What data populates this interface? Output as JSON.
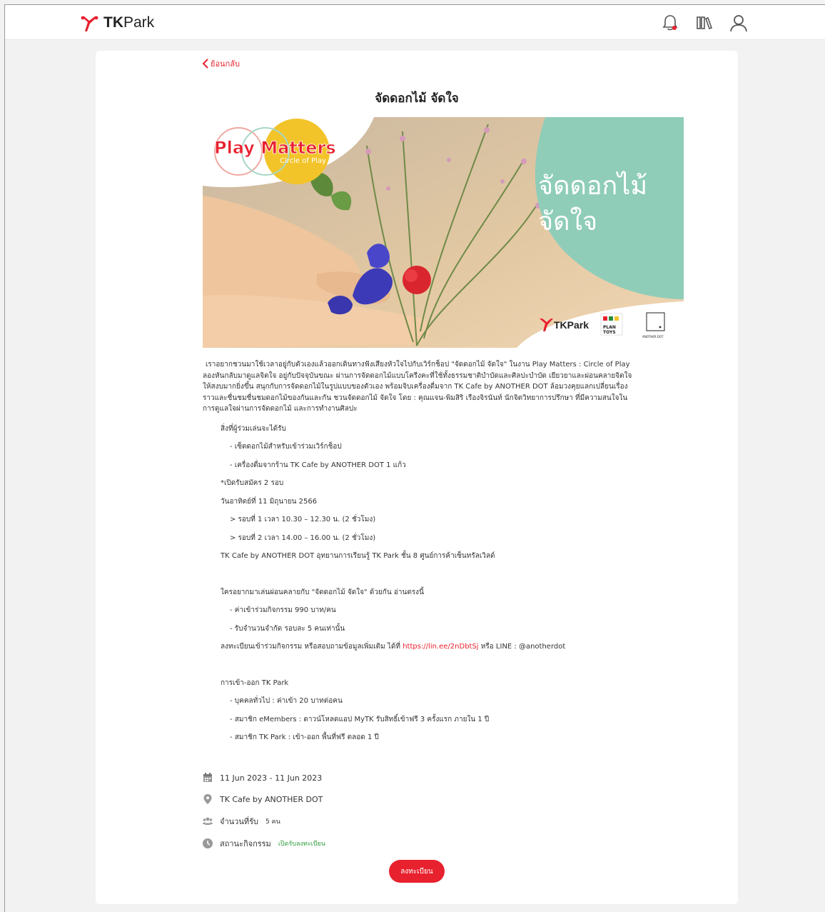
{
  "header": {
    "brand_tk": "TK",
    "brand_park": "Park"
  },
  "page": {
    "back_label": "ย้อนกลับ",
    "title": "จัดดอกไม้ จัดใจ"
  },
  "banner": {
    "logo_line1": "Play Matters",
    "logo_line2": "Circle of Play",
    "headline_1": "จัดดอกไม้",
    "headline_2": "จัดใจ",
    "sponsor_tkpark": "TKPark",
    "sponsor_plantoys_1": "PLAN",
    "sponsor_plantoys_2": "TOYS",
    "sponsor_anotherdot": "ANOTHER DOT"
  },
  "details": {
    "intro": "เราอยากชวนมาใช้เวลาอยู่กับตัวเองแล้วออกเดินทางฟังเสียงหัวใจไปกับเวิร์กช็อป \"จัดดอกไม้ จัดใจ\" ในงาน Play Matters : Circle of Play ลองหันกลับมาดูแลจิตใจ อยู่กับปัจจุบันขณะ ผ่านการจัดดอกไม้แบบโครีงคะที่ใช้ทั้งธรรมชาติบำบัดและศิลปะบำบัด เยียวยาและผ่อนคลายจิตใจให้สงบมากยิ่งขึ้น สนุกกับการจัดดอกไม้ในรูปแบบของตัวเอง พร้อมจิบเครื่องดื่มจาก TK Cafe by ANOTHER DOT ล้อมวงคุยแลกเปลี่ยนเรื่องราวและชื่นชมชื่นชมดอกไม้ของกันและกัน ชวนจัดดอกไม้ จัดใจ โดย : คุณแจน-พิมสิริ เรืองจิรนันท์ นักจิตวิทยาการปรึกษา ที่มีความสนใจในการดูแลใจผ่านการจัดดอกไม้ และการทำงานศิลปะ",
    "receive_heading": "สิ่งที่ผู้ร่วมเล่นจะได้รับ",
    "receive_1": "- เซ็ตดอกไม้สำหรับเข้าร่วมเวิร์กช็อป",
    "receive_2": "- เครื่องดื่มจากร้าน TK Cafe by ANOTHER DOT 1 แก้ว",
    "rounds_note": "*เปิดรับสมัคร 2 รอบ",
    "date_line": "วันอาทิตย์ที่ 11 มิถุนายน 2566",
    "round_1": "> รอบที่ 1    เวลา 10.30 – 12.30 น. (2 ชั่วโมง)",
    "round_2": "> รอบที่ 2    เวลา 14.00 – 16.00 น. (2 ชั่วโมง)",
    "venue_line": "TK Cafe by ANOTHER DOT อุทยานการเรียนรู้ TK Park ชั้น 8 ศูนย์การค้าเซ็นทรัลเวิลด์",
    "invite_line": "ใครอยากมาเล่นผ่อนคลายกับ \"จัดดอกไม้ จัดใจ\" ด้วยกัน อ่านตรงนี้",
    "fee_line": "- ค่าเข้าร่วมกิจกรรม 990 บาท/คน",
    "limit_line": "- รับจำนวนจำกัด รอบละ 5 คนเท่านั้น",
    "register_prefix": "ลงทะเบียนเข้าร่วมกิจกรรม หรือสอบถามข้อมูลเพิ่มเติม ได้ที่ ",
    "register_link": "https://lin.ee/2nDbtSj",
    "register_suffix": " หรือ LINE : @anotherdot",
    "entry_heading": "การเข้า-ออก TK Park",
    "entry_1": "- บุคคลทั่วไป : ค่าเข้า 20 บาทต่อคน",
    "entry_2": "- สมาชิก eMembers : ดาวน์โหลดแอป MyTK รับสิทธิ์เข้าฟรี 3 ครั้งแรก ภายใน 1 ปี",
    "entry_3": "- สมาชิก TK Park : เข้า-ออก พื้นที่ฟรี ตลอด 1 ปี"
  },
  "meta": {
    "date_range": "11 Jun 2023 - 11 Jun 2023",
    "location": "TK Cafe by ANOTHER DOT",
    "capacity_label": "จำนวนที่รับ",
    "capacity_value": "5 คน",
    "status_label": "สถานะกิจกรรม",
    "status_value": "เปิดรับลงทะเบียน"
  },
  "actions": {
    "register_button": "ลงทะเบียน"
  },
  "colors": {
    "brand_red": "#e8212e",
    "teal": "#8fcdb9",
    "status_green": "#2e9c3a"
  },
  "icons": [
    "tkpark-logo-icon",
    "bell-icon",
    "books-icon",
    "user-icon",
    "chevron-left-icon",
    "calendar-icon",
    "location-pin-icon",
    "people-icon",
    "clock-icon"
  ]
}
